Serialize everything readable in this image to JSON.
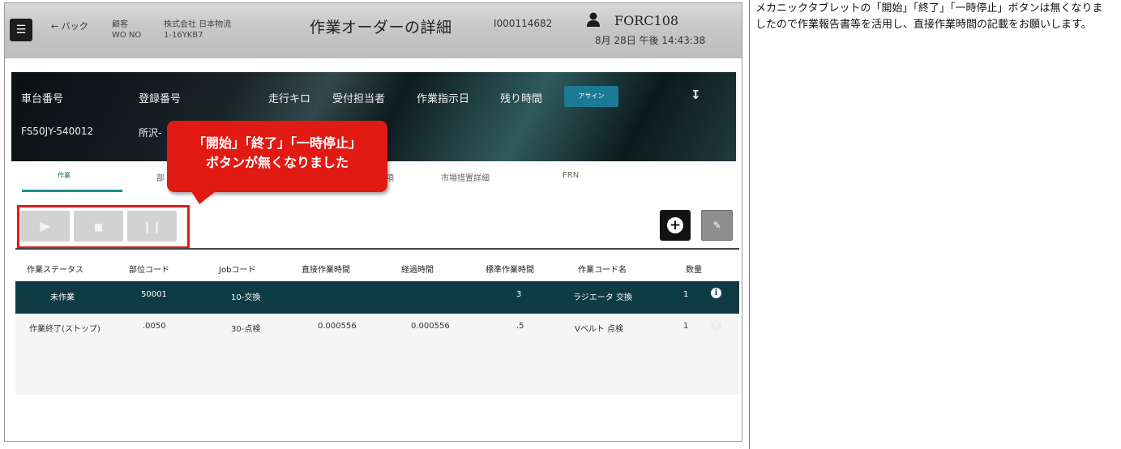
{
  "header": {
    "menu_icon": "hamburger-icon",
    "back_label": "← バック",
    "customer_label": "顧客",
    "customer_value": "株式会社 日本物流",
    "wo_label": "WO NO",
    "wo_value": "1-16YKB7",
    "title": "作業オーダーの詳細",
    "order_id": "I000114682",
    "user_icon": "person-icon",
    "user_name": "FORC108",
    "datetime": "8月 28日 午後 14:43:38"
  },
  "banner": {
    "labels": {
      "chassis": "車台番号",
      "registration": "登録番号",
      "mileage": "走行キロ",
      "receptionist": "受付担当者",
      "instruction_date": "作業指示日",
      "remaining": "残り時間"
    },
    "values": {
      "chassis": "FS50JY-540012",
      "registration": "所沢-"
    },
    "assign_label": "アサイン",
    "download_icon": "download-arrow-icon"
  },
  "tabs": [
    "作業",
    "部",
    "項",
    "市場措置詳細",
    "FRN"
  ],
  "callout": {
    "line1": "「開始」「終了」「一時停止」",
    "line2": "ボタンが無くなりました"
  },
  "controls": {
    "start_icon": "play-icon",
    "stop_icon": "stop-icon",
    "pause_icon": "pause-icon",
    "add_icon": "plus-circle-icon",
    "edit_icon": "edit-icon"
  },
  "table": {
    "columns": [
      "作業ステータス",
      "部位コード",
      "Jobコード",
      "直接作業時間",
      "経過時間",
      "標準作業時間",
      "作業コード名",
      "数量"
    ],
    "rows": [
      [
        "未作業",
        "50001",
        "10-交換",
        "",
        "",
        "3",
        "ラジエータ 交換",
        "1"
      ],
      [
        "作業終了(ストップ)",
        ".0050",
        "30-点検",
        "0.000556",
        "0.000556",
        ".5",
        "Vベルト 点検",
        "1"
      ]
    ],
    "info_icon": "info-icon"
  },
  "note": "メカニックタブレットの「開始」「終了」「一時停止」ボタンは無くなりましたので作業報告書等を活用し、直接作業時間の記載をお願いします。",
  "colors": {
    "accent": "#1c8f8a",
    "selected_row": "#0f3b45",
    "callout": "#e21a14",
    "assign_button": "#1b7a94"
  }
}
